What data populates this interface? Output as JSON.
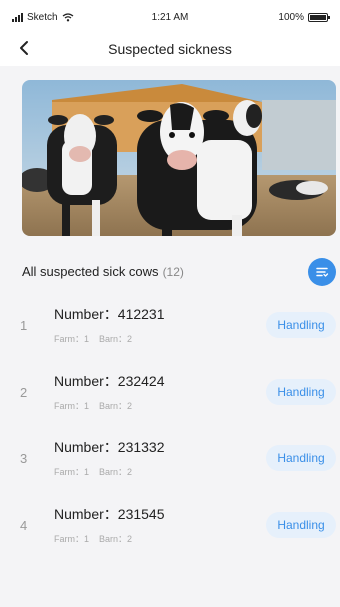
{
  "status_bar": {
    "carrier": "Sketch",
    "time": "1:21 AM",
    "battery": "100%",
    "battery_level": 1.0
  },
  "nav": {
    "title": "Suspected sickness"
  },
  "section": {
    "title": "All suspected sick cows",
    "count": "(12)"
  },
  "colors": {
    "accent": "#3a8fe8",
    "pill_bg": "#e6f0fb"
  },
  "items": [
    {
      "index": "1",
      "number": "Number：412231",
      "farm": "Farm：1",
      "barn": "Barn：2",
      "status": "Handling"
    },
    {
      "index": "2",
      "number": "Number：232424",
      "farm": "Farm：1",
      "barn": "Barn：2",
      "status": "Handling"
    },
    {
      "index": "3",
      "number": "Number：231332",
      "farm": "Farm：1",
      "barn": "Barn：2",
      "status": "Handling"
    },
    {
      "index": "4",
      "number": "Number：231545",
      "farm": "Farm：1",
      "barn": "Barn：2",
      "status": "Handling"
    }
  ]
}
